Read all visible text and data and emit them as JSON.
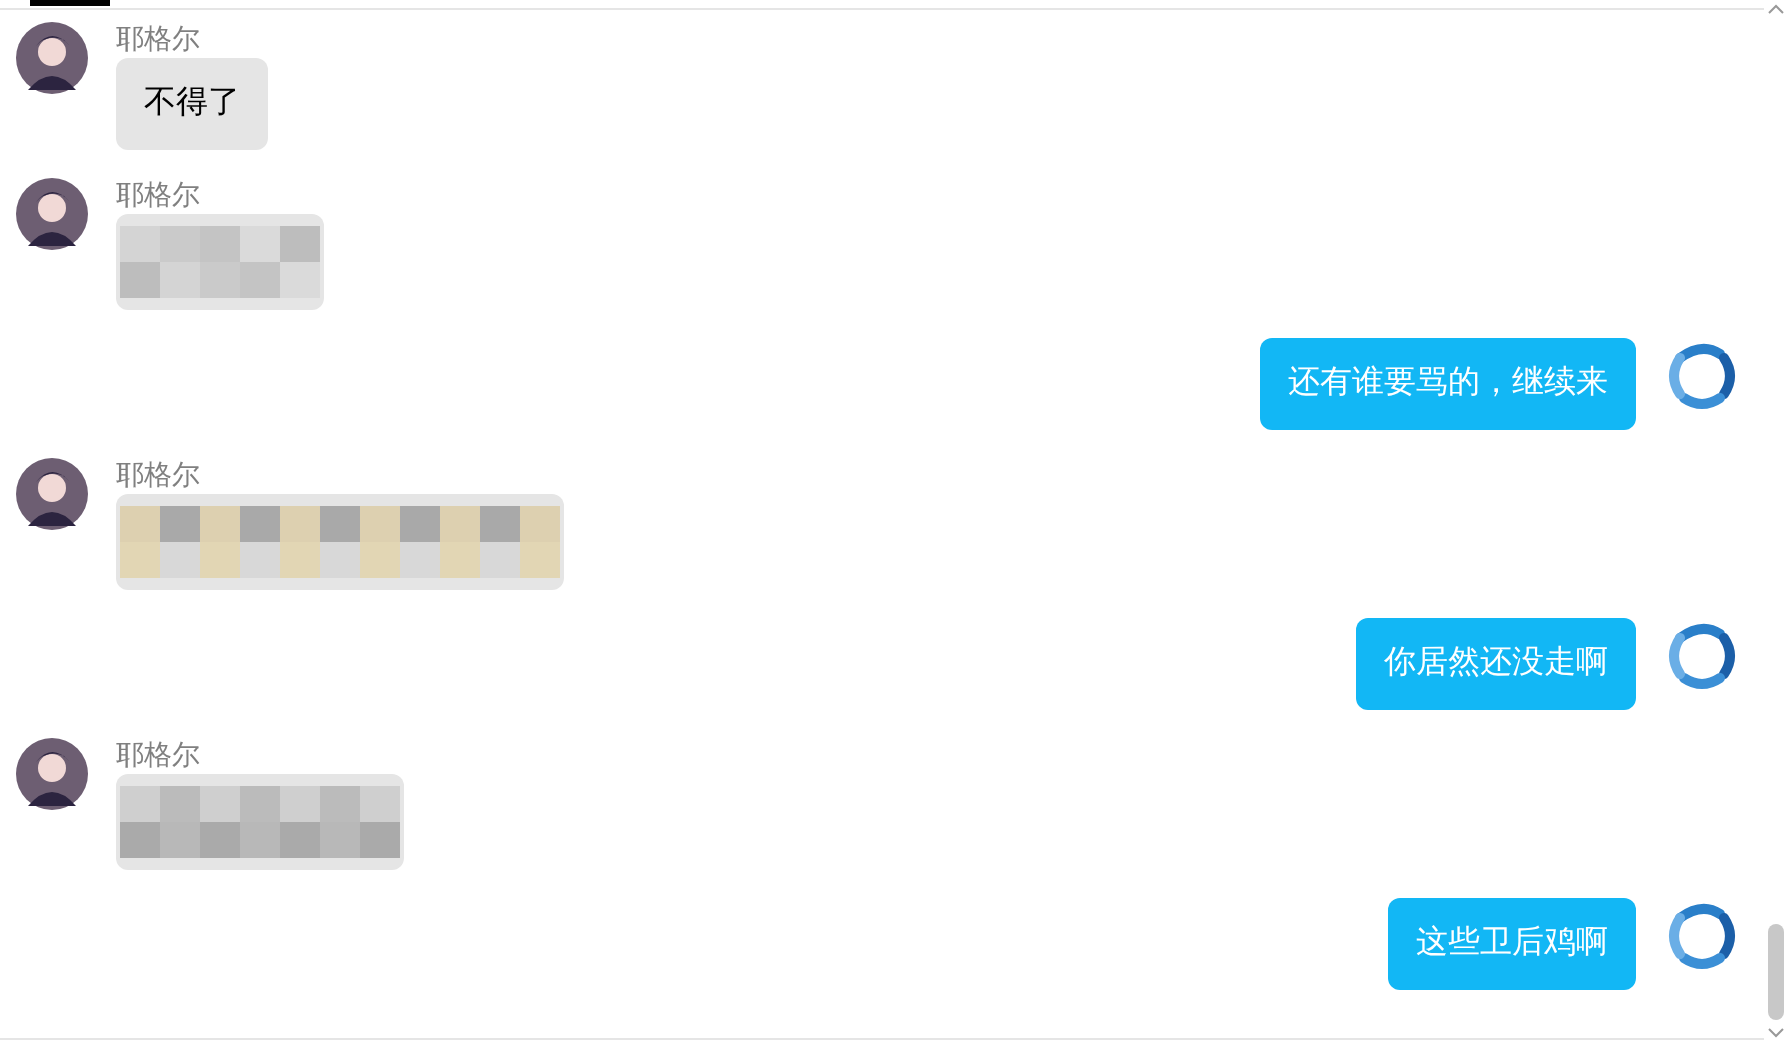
{
  "messages": [
    {
      "kind": "received_text",
      "name": "耶格尔",
      "text": "不得了"
    },
    {
      "kind": "received_picture",
      "name": "耶格尔"
    },
    {
      "kind": "sent_text",
      "text": "还有谁要骂的，继续来"
    },
    {
      "kind": "received_picture",
      "name": "耶格尔"
    },
    {
      "kind": "sent_text",
      "text": "你居然还没走啊"
    },
    {
      "kind": "received_picture",
      "name": "耶格尔"
    },
    {
      "kind": "sent_text",
      "text": "这些卫后鸡啊"
    }
  ]
}
